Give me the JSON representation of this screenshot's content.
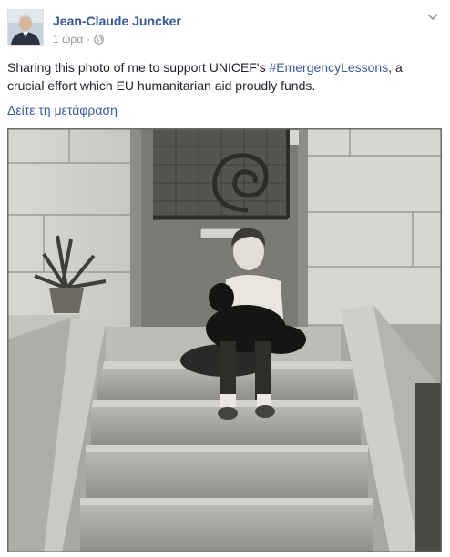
{
  "post": {
    "author": "Jean-Claude Juncker",
    "time": "1 ώρα",
    "separator": "·",
    "text_before": "Sharing this photo of me to support UNICEF's ",
    "hashtag": "#EmergencyLessons",
    "text_after": ", a crucial effort which EU humanitarian aid proudly funds.",
    "translate_link": "Δείτε τη μετάφραση"
  },
  "icons": {
    "avatar": "profile-photo",
    "privacy": "globe-icon",
    "menu": "chevron-down-icon"
  },
  "colors": {
    "link": "#365899",
    "text": "#1d2129",
    "meta": "#90949c"
  }
}
